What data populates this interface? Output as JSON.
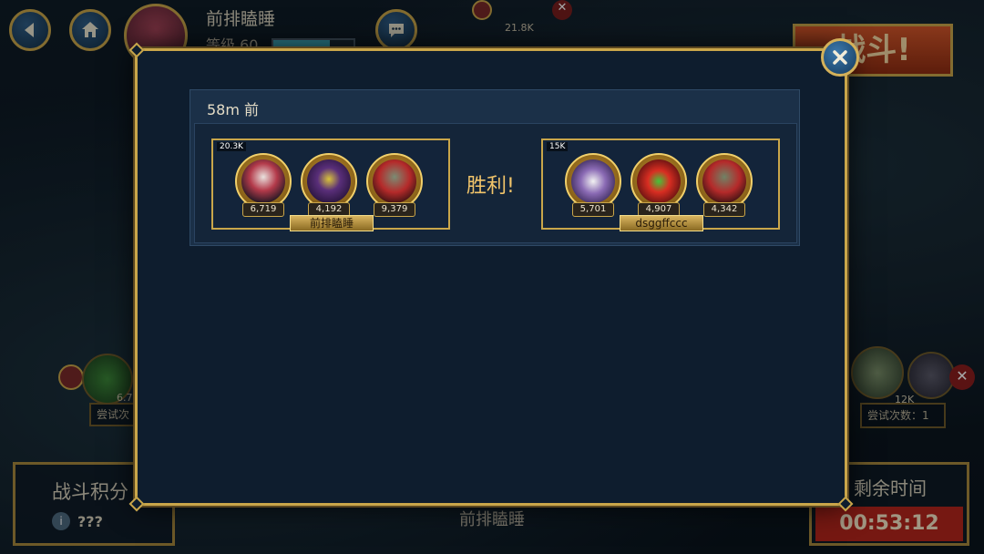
{
  "background": {
    "player": {
      "name": "前排瞌睡",
      "level_label": "等级 60",
      "level_progress": 0.7
    },
    "top_center": {
      "power": "21.8K"
    },
    "fight_button": {
      "label": "战斗!"
    },
    "left_team": {
      "power": "6.7",
      "attempts": "尝试次"
    },
    "right_team": {
      "power": "12K",
      "attempts": "尝试次数：1"
    },
    "battle_score": {
      "title": "战斗积分",
      "info_icon": "i",
      "value": "???"
    },
    "bottom_name": "前排瞌睡",
    "time": {
      "label": "剩余时间",
      "clock": "00:53:12"
    }
  },
  "modal": {
    "time_ago": "58m  前",
    "result": "胜利!",
    "left_team": {
      "power": "20.3K",
      "name": "前排瞌睡",
      "heroes": [
        {
          "icon": "maid-hero-portrait",
          "hp": "6,719"
        },
        {
          "icon": "purple-hero-portrait",
          "hp": "4,192"
        },
        {
          "icon": "red-plague-hero-portrait",
          "hp": "9,379"
        }
      ]
    },
    "right_team": {
      "power": "15K",
      "name": "dsggffccc",
      "heroes": [
        {
          "icon": "top-hat-hero-portrait",
          "hp": "5,701"
        },
        {
          "icon": "red-demon-hero-portrait",
          "hp": "4,907"
        },
        {
          "icon": "red-plague-hero-portrait",
          "hp": "4,342"
        }
      ]
    }
  }
}
